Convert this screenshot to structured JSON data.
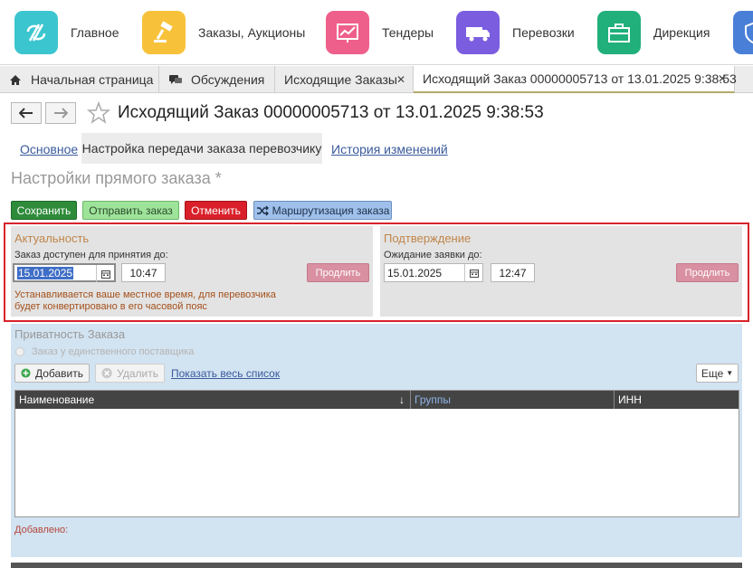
{
  "sections": [
    {
      "label": "Главное",
      "icon": "main-logo-icon",
      "color": "#3bc5cf"
    },
    {
      "label": "Заказы, Аукционы",
      "icon": "auction-hammer-icon",
      "color": "#f7c23a"
    },
    {
      "label": "Тендеры",
      "icon": "chart-board-icon",
      "color": "#ef5f8b"
    },
    {
      "label": "Перевозки",
      "icon": "truck-icon",
      "color": "#7b5de0"
    },
    {
      "label": "Дирекция",
      "icon": "briefcase-icon",
      "color": "#21b07b"
    }
  ],
  "tabs": {
    "home": "Начальная страница",
    "discussions": "Обсуждения",
    "outgoing": "Исходящие Заказы",
    "current": "Исходящий Заказ 00000005713 от 13.01.2025 9:38:53"
  },
  "title": "Исходящий Заказ 00000005713 от 13.01.2025 9:38:53",
  "subtabs": {
    "main": "Основное",
    "settings": "Настройка передачи заказа перевозчику",
    "history": "История изменений"
  },
  "form_title": "Настройки прямого заказа *",
  "actions": {
    "save": "Сохранить",
    "send": "Отправить заказ",
    "cancel": "Отменить",
    "route": "Маршрутизация заказа"
  },
  "relevance": {
    "title": "Актуальность",
    "label": "Заказ доступен для принятия до:",
    "date": "15.01.2025",
    "time": "10:47",
    "extend": "Продлить",
    "note_line1": "Устанавливается ваше местное время, для перевозчика",
    "note_line2": "будет конвертировано в его часовой пояс"
  },
  "confirmation": {
    "title": "Подтверждение",
    "label": "Ожидание заявки до:",
    "date": "15.01.2025",
    "time": "12:47",
    "extend": "Продлить"
  },
  "privacy": {
    "title": "Приватность Заказа",
    "radio": "Заказ у единственного поставщика",
    "add": "Добавить",
    "delete": "Удалить",
    "show_all": "Показать весь список",
    "more": "Еще",
    "columns": [
      "Наименование",
      "Группы",
      "ИНН"
    ],
    "added_label": "Добавлено:"
  }
}
